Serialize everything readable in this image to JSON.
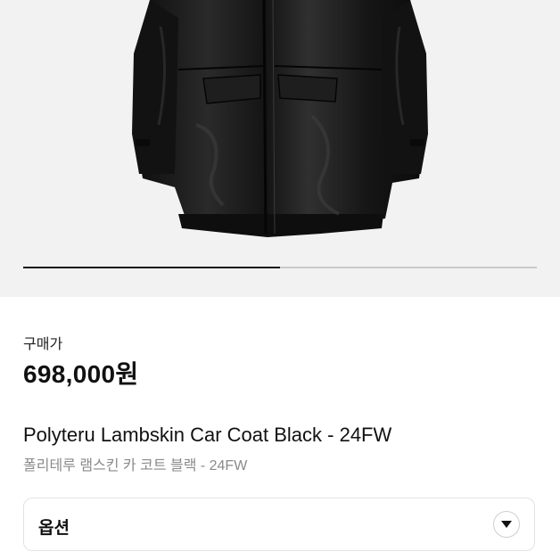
{
  "product_image": {
    "alt": "Polyteru Lambskin Car Coat Black",
    "carousel_progress": 0.5
  },
  "purchase": {
    "price_label": "구매가",
    "price": "698,000원"
  },
  "product": {
    "title": "Polyteru Lambskin Car Coat Black - 24FW",
    "subtitle": "폴리테루 램스킨 카 코트 블랙 - 24FW"
  },
  "options": {
    "label": "옵션",
    "icon": "chevron-down-icon"
  },
  "colors": {
    "image_bg": "#f2f2f2",
    "coat": "#1a1a1a",
    "progress_fill": "#111111",
    "progress_track": "#c9c9c9"
  }
}
